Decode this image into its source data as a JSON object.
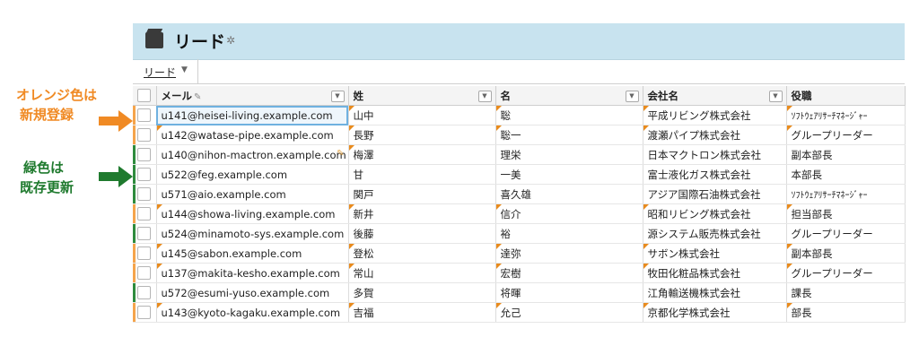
{
  "annotations": {
    "orange_line1": "オレンジ色は",
    "orange_line2": "新規登録",
    "green_line1": "緑色は",
    "green_line2": "既存更新",
    "orange_color": "#f08a24",
    "green_color": "#1f7a2e"
  },
  "header": {
    "title": "リード",
    "icon": "folder-icon",
    "gear_icon": "gear-icon"
  },
  "view": {
    "label": "リード",
    "caret": "▼"
  },
  "columns": [
    "メール",
    "姓",
    "名",
    "会社名",
    "役職"
  ],
  "rows": [
    {
      "mark": "orange",
      "email": "u141@heisei-living.example.com",
      "last": "山中",
      "first": "聡",
      "company": "平成リビング株式会社",
      "title": "ｿﾌﾄｳｪｱﾘｻｰﾁﾏﾈｰｼﾞｬｰ"
    },
    {
      "mark": "orange",
      "email": "u142@watase-pipe.example.com",
      "last": "長野",
      "first": "聡一",
      "company": "渡瀬パイプ株式会社",
      "title": "グループリーダー"
    },
    {
      "mark": "green",
      "email": "u140@nihon-mactron.example.com",
      "last": "梅澤",
      "first": "理栄",
      "company": "日本マクトロン株式会社",
      "title": "副本部長"
    },
    {
      "mark": "green",
      "email": "u522@feg.example.com",
      "last": "甘",
      "first": "一美",
      "company": "富士液化ガス株式会社",
      "title": "本部長"
    },
    {
      "mark": "green",
      "email": "u571@aio.example.com",
      "last": "関戸",
      "first": "喜久雄",
      "company": "アジア国際石油株式会社",
      "title": "ｿﾌﾄｳｪｱﾘｻｰﾁﾏﾈｰｼﾞｬｰ"
    },
    {
      "mark": "orange",
      "email": "u144@showa-living.example.com",
      "last": "新井",
      "first": "信介",
      "company": "昭和リビング株式会社",
      "title": "担当部長"
    },
    {
      "mark": "green",
      "email": "u524@minamoto-sys.example.com",
      "last": "後藤",
      "first": "裕",
      "company": "源システム販売株式会社",
      "title": "グループリーダー"
    },
    {
      "mark": "orange",
      "email": "u145@sabon.example.com",
      "last": "登松",
      "first": "達弥",
      "company": "サボン株式会社",
      "title": "副本部長"
    },
    {
      "mark": "orange",
      "email": "u137@makita-kesho.example.com",
      "last": "常山",
      "first": "宏樹",
      "company": "牧田化粧品株式会社",
      "title": "グループリーダー"
    },
    {
      "mark": "green",
      "email": "u572@esumi-yuso.example.com",
      "last": "多賀",
      "first": "将暉",
      "company": "江角輸送機株式会社",
      "title": "課長"
    },
    {
      "mark": "orange",
      "email": "u143@kyoto-kagaku.example.com",
      "last": "吉福",
      "first": "允己",
      "company": "京都化学株式会社",
      "title": "部長"
    }
  ]
}
